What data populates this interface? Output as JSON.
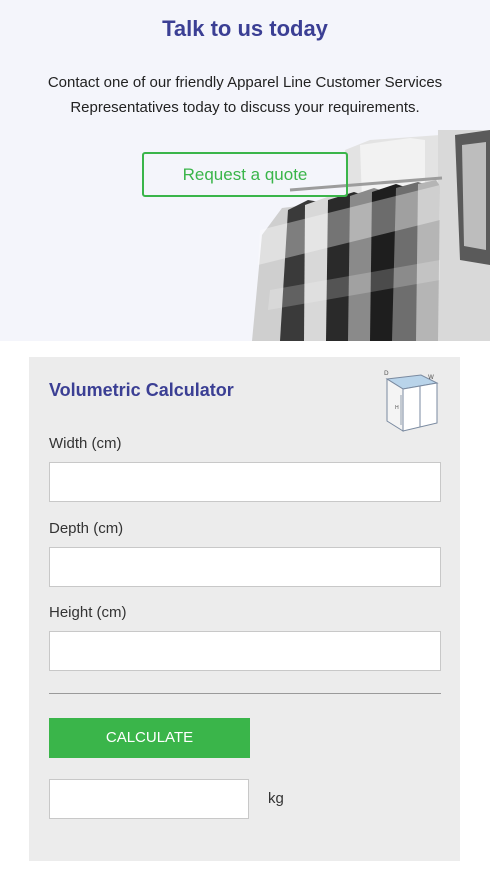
{
  "hero": {
    "title": "Talk to us today",
    "text": "Contact one of our friendly Apparel Line Customer Services Representatives today to discuss your requirements.",
    "quote_button": "Request a quote"
  },
  "calculator": {
    "title": "Volumetric Calculator",
    "icon": "box-dimensions-icon",
    "icon_labels": {
      "depth": "D",
      "width": "W",
      "height": "H"
    },
    "fields": [
      {
        "label": "Width (cm)",
        "value": "",
        "placeholder": ""
      },
      {
        "label": "Depth (cm)",
        "value": "",
        "placeholder": ""
      },
      {
        "label": "Height (cm)",
        "value": "",
        "placeholder": ""
      }
    ],
    "calculate_button": "CALCULATE",
    "result": {
      "value": "",
      "unit": "kg"
    }
  },
  "colors": {
    "accent_green": "#3ab54a",
    "title_blue": "#3b3f94",
    "hero_background": "#f4f5fb",
    "panel_background": "#ececec"
  }
}
